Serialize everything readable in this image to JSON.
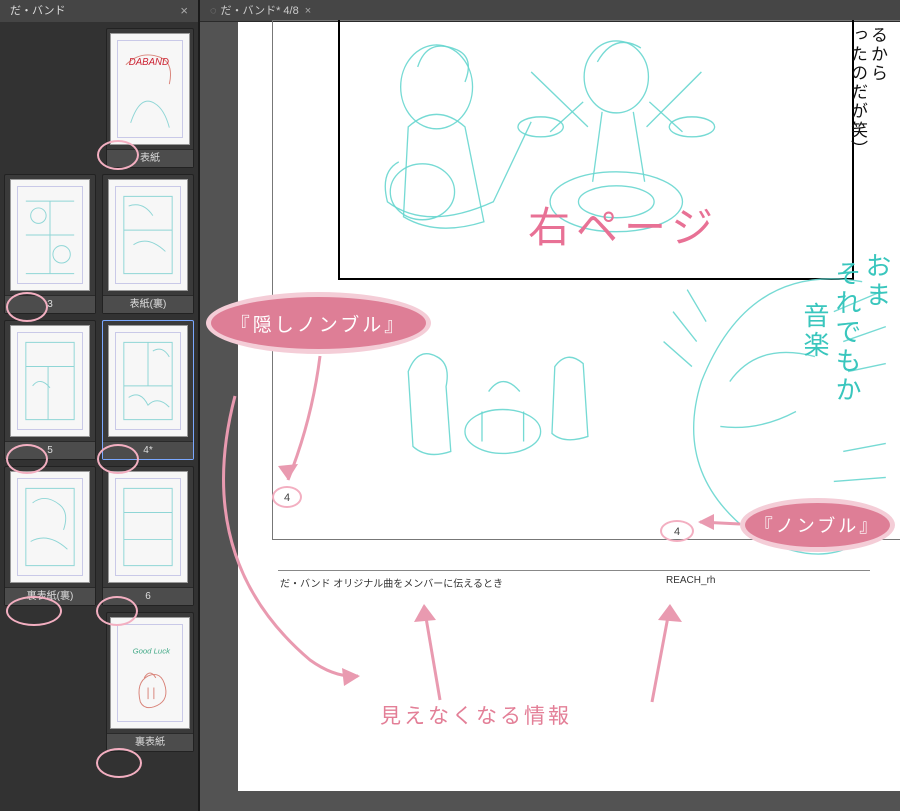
{
  "side": {
    "tab_title": "だ・バンド",
    "thumbs": [
      {
        "label": "表紙",
        "solo": true,
        "cover": true
      },
      {
        "label": "3"
      },
      {
        "label": "表紙(裏)"
      },
      {
        "label": "5"
      },
      {
        "label": "4*",
        "selected": true
      },
      {
        "label": "裏表紙(裏)"
      },
      {
        "label": "6"
      },
      {
        "label": "裏表紙",
        "solo": true,
        "back": true
      }
    ]
  },
  "main": {
    "tab_title": "だ・バンド* 4/8",
    "vertical_text_black": "ったのだが笑）",
    "vertical_text_black_pre": "るから",
    "teal_lines": [
      "おま",
      "それでもか",
      "音楽"
    ],
    "page_title_note": "右ページ",
    "hidden_nombre_value": "4",
    "nombre_value": "4",
    "footer_left": "だ・バンド オリジナル曲をメンバーに伝えるとき",
    "footer_right": "REACH_rh"
  },
  "annotations": {
    "bubble_hidden": "『隠しノンブル』",
    "bubble_nombre": "『ノンブル』",
    "caption": "見えなくなる情報"
  },
  "colors": {
    "pink": "#e87195",
    "teal": "#67d6cf",
    "panel": "#323232"
  }
}
